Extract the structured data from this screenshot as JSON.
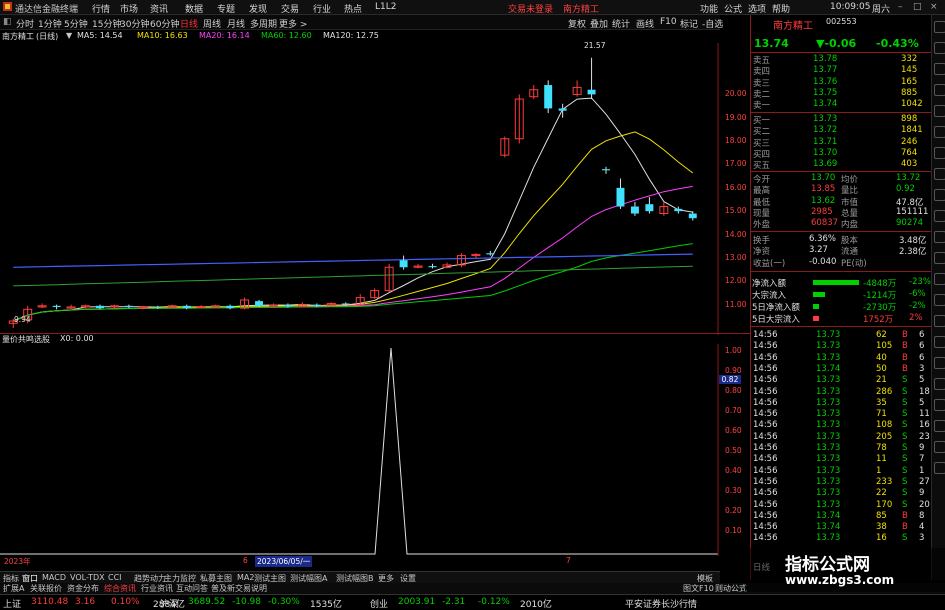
{
  "app": {
    "title": "通达信金融终端",
    "menu": [
      "行情",
      "市场",
      "资讯",
      "数据",
      "专题",
      "发现",
      "交易",
      "行业",
      "热点",
      "L1L2"
    ],
    "center_links": [
      "交易未登录",
      "南方精工"
    ],
    "right_menu": [
      "功能",
      "公式",
      "选项",
      "帮助"
    ],
    "clock": "10:09:05",
    "weekday": "周六"
  },
  "chart_header": {
    "stock": "南方精工",
    "period": "(日线)",
    "ma": [
      {
        "label": "MA5: 14.54",
        "color": "#e0e0e0"
      },
      {
        "label": "MA10: 16.63",
        "color": "#f0e000"
      },
      {
        "label": "MA20: 16.14",
        "color": "#ff40ff"
      },
      {
        "label": "MA60: 12.60",
        "color": "#00d000"
      },
      {
        "label": "MA120: 12.75",
        "color": "#e0e0e0"
      }
    ]
  },
  "period_tabs": [
    {
      "label": "分时",
      "active": false
    },
    {
      "label": "1分钟",
      "active": false
    },
    {
      "label": "5分钟",
      "active": false
    },
    {
      "label": "15分钟",
      "active": false
    },
    {
      "label": "30分钟",
      "active": false
    },
    {
      "label": "60分钟",
      "active": false
    },
    {
      "label": "日线",
      "active": true
    },
    {
      "label": "周线",
      "active": false
    },
    {
      "label": "月线",
      "active": false
    },
    {
      "label": "多周期",
      "active": false
    },
    {
      "label": "更多 >",
      "active": false
    }
  ],
  "toolbar_right": [
    "复权",
    "叠加",
    "统计",
    "画线",
    "F10",
    "标记",
    "-自选"
  ],
  "y_axis_main": [
    "20.00",
    "19.00",
    "18.00",
    "17.00",
    "16.00",
    "15.00",
    "14.00",
    "13.00",
    "12.00",
    "11.00"
  ],
  "y_axis_sub": [
    "1.00",
    "0.90",
    "0.80",
    "0.70",
    "0.60",
    "0.50",
    "0.40",
    "0.30",
    "0.20",
    "0.10"
  ],
  "sub_current": "0.82",
  "high_label": "21.57",
  "low_label": "9.94",
  "sub_indicator": {
    "name": "量价共鸣选股",
    "value": "X0: 0.00"
  },
  "date_axis": {
    "left": "2023年",
    "cursor": "2023/06/05/一",
    "mark2": "6",
    "mark3": "7"
  },
  "quote": {
    "name": "南方精工",
    "code": "002553",
    "price": "13.74",
    "change": "▼-0.06",
    "pct": "-0.43%",
    "asks": [
      {
        "label": "卖五",
        "price": "13.78",
        "vol": "332"
      },
      {
        "label": "卖四",
        "price": "13.77",
        "vol": "145"
      },
      {
        "label": "卖三",
        "price": "13.76",
        "vol": "165"
      },
      {
        "label": "卖二",
        "price": "13.75",
        "vol": "885"
      },
      {
        "label": "卖一",
        "price": "13.74",
        "vol": "1042"
      }
    ],
    "bids": [
      {
        "label": "买一",
        "price": "13.73",
        "vol": "898"
      },
      {
        "label": "买二",
        "price": "13.72",
        "vol": "1841"
      },
      {
        "label": "买三",
        "price": "13.71",
        "vol": "246"
      },
      {
        "label": "买四",
        "price": "13.70",
        "vol": "764"
      },
      {
        "label": "买五",
        "price": "13.69",
        "vol": "403"
      }
    ],
    "stats": [
      {
        "l1": "今开",
        "v1": "13.70",
        "c1": "grn",
        "l2": "均价",
        "v2": "13.72",
        "c2": "grn"
      },
      {
        "l1": "最高",
        "v1": "13.85",
        "c1": "red",
        "l2": "量比",
        "v2": "0.92",
        "c2": "grn"
      },
      {
        "l1": "最低",
        "v1": "13.62",
        "c1": "grn",
        "l2": "市值",
        "v2": "47.8亿",
        "c2": "wht"
      },
      {
        "l1": "现量",
        "v1": "2985",
        "c1": "red",
        "l2": "总量",
        "v2": "151111",
        "c2": "wht"
      },
      {
        "l1": "外盘",
        "v1": "60837",
        "c1": "red",
        "l2": "内盘",
        "v2": "90274",
        "c2": "grn"
      }
    ],
    "stats2": [
      {
        "l1": "换手",
        "v1": "6.36%",
        "l2": "股本",
        "v2": "3.48亿"
      },
      {
        "l1": "净资",
        "v1": "3.27",
        "l2": "流通",
        "v2": "2.38亿"
      },
      {
        "l1": "收益(一)",
        "v1": "-0.040",
        "l2": "PE(动)",
        "v2": ""
      }
    ],
    "flows": [
      {
        "label": "净流入额",
        "value": "-4848万",
        "pct": "-23%",
        "color": "#00d000",
        "fill": 0.23
      },
      {
        "label": "大宗流入",
        "value": "-1214万",
        "pct": "-6%",
        "color": "#00d000",
        "fill": 0.06
      },
      {
        "label": "5日净流入额",
        "value": "-2730万",
        "pct": "-2%",
        "color": "#00d000",
        "fill": 0.02
      },
      {
        "label": "5日大宗流入",
        "value": "1752万",
        "pct": "2%",
        "color": "#ff3c3c",
        "fill": 0.02
      }
    ],
    "ticks": [
      {
        "t": "14:56",
        "p": "13.73",
        "v": "62",
        "d": "B",
        "n": "6"
      },
      {
        "t": "14:56",
        "p": "13.73",
        "v": "105",
        "d": "B",
        "n": "6"
      },
      {
        "t": "14:56",
        "p": "13.73",
        "v": "40",
        "d": "B",
        "n": "6"
      },
      {
        "t": "14:56",
        "p": "13.74",
        "v": "50",
        "d": "B",
        "n": "3"
      },
      {
        "t": "14:56",
        "p": "13.73",
        "v": "21",
        "d": "S",
        "n": "5"
      },
      {
        "t": "14:56",
        "p": "13.73",
        "v": "286",
        "d": "S",
        "n": "18"
      },
      {
        "t": "14:56",
        "p": "13.73",
        "v": "35",
        "d": "S",
        "n": "5"
      },
      {
        "t": "14:56",
        "p": "13.73",
        "v": "71",
        "d": "S",
        "n": "11"
      },
      {
        "t": "14:56",
        "p": "13.73",
        "v": "108",
        "d": "S",
        "n": "16"
      },
      {
        "t": "14:56",
        "p": "13.73",
        "v": "205",
        "d": "S",
        "n": "23"
      },
      {
        "t": "14:56",
        "p": "13.73",
        "v": "78",
        "d": "S",
        "n": "9"
      },
      {
        "t": "14:56",
        "p": "13.73",
        "v": "11",
        "d": "S",
        "n": "7"
      },
      {
        "t": "14:56",
        "p": "13.73",
        "v": "1",
        "d": "S",
        "n": "1"
      },
      {
        "t": "14:56",
        "p": "13.73",
        "v": "233",
        "d": "S",
        "n": "27"
      },
      {
        "t": "14:56",
        "p": "13.73",
        "v": "22",
        "d": "S",
        "n": "9"
      },
      {
        "t": "14:56",
        "p": "13.73",
        "v": "170",
        "d": "S",
        "n": "20"
      },
      {
        "t": "14:56",
        "p": "13.74",
        "v": "85",
        "d": "B",
        "n": "8"
      },
      {
        "t": "14:56",
        "p": "13.74",
        "v": "38",
        "d": "B",
        "n": "4"
      },
      {
        "t": "14:56",
        "p": "13.73",
        "v": "16",
        "d": "S",
        "n": "3"
      }
    ],
    "footer_label": "日线"
  },
  "bottom_tabs": [
    "指标",
    "窗口",
    "MACD",
    "VOL-TDX",
    "CCI",
    "趋势动力",
    "主力监控",
    "私募主图",
    "MA2",
    "测试主图",
    "测试幅图A",
    "测试幅图B",
    "更多",
    "设置"
  ],
  "bottom_tabs_right": "模板",
  "bottom_tabs2": [
    "扩展A",
    "关联报价",
    "资金分布",
    "综合资讯",
    "行业资讯",
    "互动问答",
    "普及新交易说明"
  ],
  "bottom_tabs2_right": [
    "图文F10",
    "则动公式"
  ],
  "status": [
    {
      "label": "上证",
      "v1": "3110.48",
      "v2": "3.16",
      "v3": "0.10%",
      "v4": "2884亿"
    },
    {
      "label": "沪深",
      "v1": "3689.52",
      "v2": "-10.98",
      "v3": "-0.30%",
      "v4": "1535亿"
    },
    {
      "label": "创业",
      "v1": "2003.91",
      "v2": "-2.31",
      "v3": "-0.12%",
      "v4": "2010亿"
    }
  ],
  "status_right": "平安证券长沙行情",
  "watermark": {
    "title": "指标公式网",
    "url": "www.zbgs3.com"
  },
  "candles": [
    {
      "o": 10.2,
      "c": 10.3,
      "h": 10.4,
      "l": 10.0
    },
    {
      "o": 10.35,
      "c": 10.8,
      "h": 10.95,
      "l": 10.2
    },
    {
      "o": 10.9,
      "c": 10.95,
      "h": 11.05,
      "l": 10.85
    },
    {
      "o": 10.95,
      "c": 10.9,
      "h": 11.0,
      "l": 10.8
    },
    {
      "o": 10.85,
      "c": 10.9,
      "h": 11.0,
      "l": 10.8
    },
    {
      "o": 10.9,
      "c": 10.95,
      "h": 11.0,
      "l": 10.85
    },
    {
      "o": 10.95,
      "c": 10.85,
      "h": 11.0,
      "l": 10.8
    },
    {
      "o": 10.9,
      "c": 10.95,
      "h": 11.0,
      "l": 10.85
    },
    {
      "o": 10.95,
      "c": 10.9,
      "h": 11.0,
      "l": 10.85
    },
    {
      "o": 10.85,
      "c": 10.9,
      "h": 10.95,
      "l": 10.8
    },
    {
      "o": 10.9,
      "c": 10.88,
      "h": 10.95,
      "l": 10.82
    },
    {
      "o": 10.9,
      "c": 10.95,
      "h": 11.0,
      "l": 10.85
    },
    {
      "o": 10.95,
      "c": 10.85,
      "h": 11.0,
      "l": 10.8
    },
    {
      "o": 10.9,
      "c": 10.92,
      "h": 10.98,
      "l": 10.85
    },
    {
      "o": 10.92,
      "c": 10.95,
      "h": 11.0,
      "l": 10.88
    },
    {
      "o": 10.95,
      "c": 10.85,
      "h": 11.0,
      "l": 10.8
    },
    {
      "o": 10.85,
      "c": 11.2,
      "h": 11.3,
      "l": 10.8
    },
    {
      "o": 11.15,
      "c": 10.95,
      "h": 11.2,
      "l": 10.9
    },
    {
      "o": 10.95,
      "c": 10.98,
      "h": 11.05,
      "l": 10.9
    },
    {
      "o": 10.98,
      "c": 10.92,
      "h": 11.05,
      "l": 10.88
    },
    {
      "o": 10.92,
      "c": 11.0,
      "h": 11.1,
      "l": 10.9
    },
    {
      "o": 11.0,
      "c": 10.95,
      "h": 11.05,
      "l": 10.9
    },
    {
      "o": 10.95,
      "c": 11.05,
      "h": 11.1,
      "l": 10.9
    },
    {
      "o": 11.05,
      "c": 11.0,
      "h": 11.1,
      "l": 10.95
    },
    {
      "o": 11.0,
      "c": 11.3,
      "h": 11.45,
      "l": 10.95
    },
    {
      "o": 11.3,
      "c": 11.6,
      "h": 11.7,
      "l": 11.25
    },
    {
      "o": 11.6,
      "c": 12.6,
      "h": 12.75,
      "l": 11.55
    },
    {
      "o": 12.9,
      "c": 12.6,
      "h": 13.1,
      "l": 12.5
    },
    {
      "o": 12.6,
      "c": 12.65,
      "h": 12.75,
      "l": 12.55
    },
    {
      "o": 12.65,
      "c": 12.6,
      "h": 12.75,
      "l": 12.55
    },
    {
      "o": 12.6,
      "c": 12.7,
      "h": 12.8,
      "l": 12.55
    },
    {
      "o": 12.7,
      "c": 13.1,
      "h": 13.2,
      "l": 12.6
    },
    {
      "o": 13.1,
      "c": 13.15,
      "h": 13.2,
      "l": 13.0
    },
    {
      "o": 13.2,
      "c": 13.15,
      "h": 13.3,
      "l": 13.1
    },
    {
      "o": 17.4,
      "c": 18.1,
      "h": 18.2,
      "l": 17.3
    },
    {
      "o": 18.1,
      "c": 19.8,
      "h": 20.0,
      "l": 17.9
    },
    {
      "o": 19.9,
      "c": 20.2,
      "h": 20.4,
      "l": 19.8
    },
    {
      "o": 20.4,
      "c": 19.4,
      "h": 20.6,
      "l": 19.2
    },
    {
      "o": 19.4,
      "c": 19.3,
      "h": 19.6,
      "l": 19.0
    },
    {
      "o": 20.0,
      "c": 20.3,
      "h": 20.6,
      "l": 19.9
    },
    {
      "o": 20.2,
      "c": 20.0,
      "h": 21.57,
      "l": 19.8
    },
    {
      "o": 16.8,
      "c": 16.75,
      "h": 16.9,
      "l": 16.6
    },
    {
      "o": 16.0,
      "c": 15.2,
      "h": 16.4,
      "l": 15.1
    },
    {
      "o": 15.2,
      "c": 14.9,
      "h": 15.4,
      "l": 14.8
    },
    {
      "o": 15.3,
      "c": 15.0,
      "h": 15.6,
      "l": 14.9
    },
    {
      "o": 14.9,
      "c": 15.2,
      "h": 15.4,
      "l": 14.8
    },
    {
      "o": 15.1,
      "c": 15.0,
      "h": 15.2,
      "l": 14.9
    },
    {
      "o": 14.9,
      "c": 14.7,
      "h": 15.0,
      "l": 14.6
    }
  ]
}
